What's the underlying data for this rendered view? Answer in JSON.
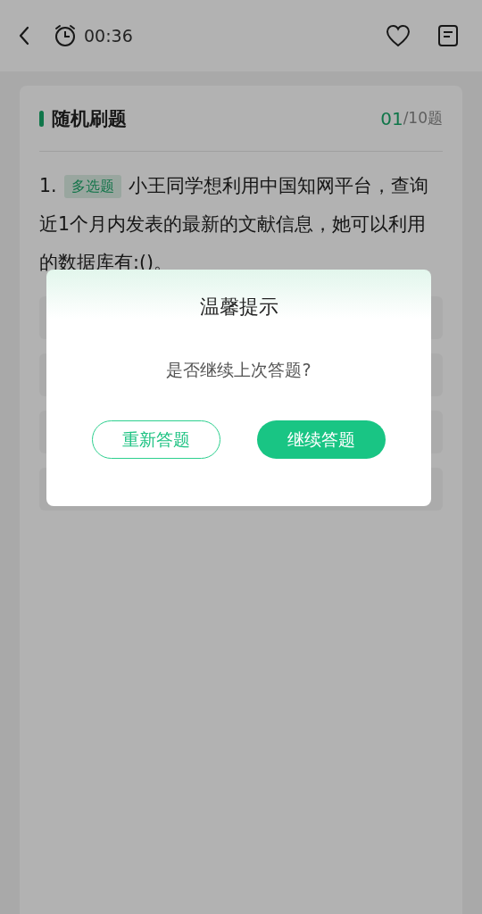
{
  "top_bar": {
    "timer": "00:36"
  },
  "card": {
    "title": "随机刷题",
    "progress_current": "01",
    "progress_total": "/10题"
  },
  "question": {
    "number": "1.",
    "tag": "多选题",
    "text_lines": [
      "小王同学想利用中国知网平台，查询",
      "近1个月内发表的最新的文献信息，她可以利用",
      "的数据库有:()。"
    ]
  },
  "dialog": {
    "title": "温馨提示",
    "message": "是否继续上次答题?",
    "buttons": [
      {
        "label": "重新答题",
        "kind": "outline"
      },
      {
        "label": "继续答题",
        "kind": "primary"
      }
    ]
  }
}
